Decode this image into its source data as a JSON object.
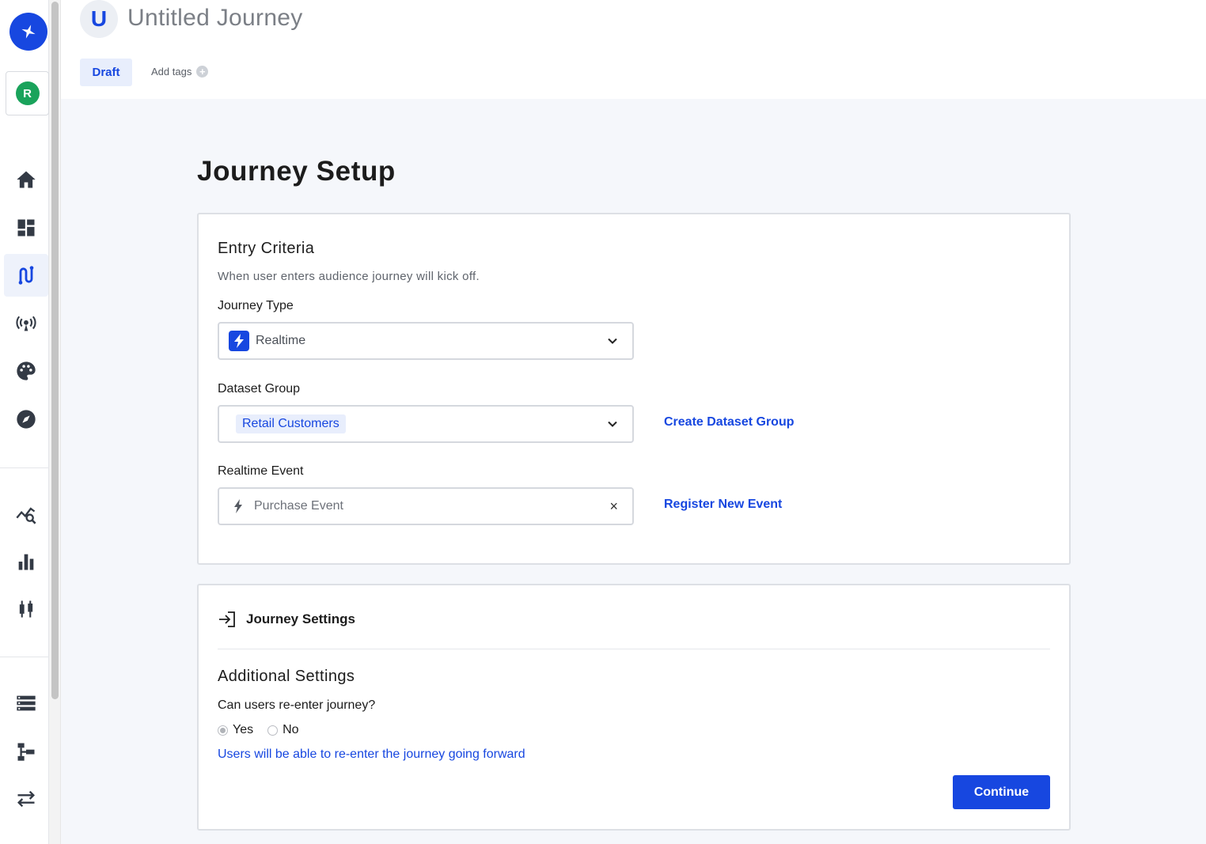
{
  "sidebar": {
    "org_initial": "R",
    "icons": [
      "sparkle-logo-icon",
      "home-icon",
      "dashboard-icon",
      "journey-icon",
      "broadcast-icon",
      "palette-icon",
      "compass-icon",
      "analytics-search-icon",
      "bar-chart-icon",
      "candlestick-icon",
      "storage-icon",
      "hierarchy-icon",
      "swap-arrows-icon"
    ],
    "active_item": "journey-icon"
  },
  "header": {
    "avatar_letter": "U",
    "title": "Untitled Journey",
    "status_badge": "Draft",
    "add_tags_label": "Add tags",
    "add_tags_icon": "+"
  },
  "main": {
    "page_title": "Journey Setup",
    "entry": {
      "heading": "Entry Criteria",
      "helper": "When user enters audience journey will kick off.",
      "journey_type": {
        "label": "Journey Type",
        "value": "Realtime"
      },
      "dataset_group": {
        "label": "Dataset Group",
        "value": "Retail Customers",
        "link": "Create Dataset Group"
      },
      "realtime_event": {
        "label": "Realtime Event",
        "value": "Purchase Event",
        "clear": "×",
        "link": "Register New Event"
      }
    },
    "settings": {
      "title": "Journey Settings",
      "sub_heading": "Additional Settings",
      "question": "Can users re-enter journey?",
      "options": [
        "Yes",
        "No"
      ],
      "selected": "Yes",
      "note": "Users will be able to re-enter the journey going forward",
      "continue_label": "Continue"
    }
  },
  "colors": {
    "accent": "#1747e0",
    "background": "#f5f7fb",
    "org_avatar": "#1aa35b"
  }
}
